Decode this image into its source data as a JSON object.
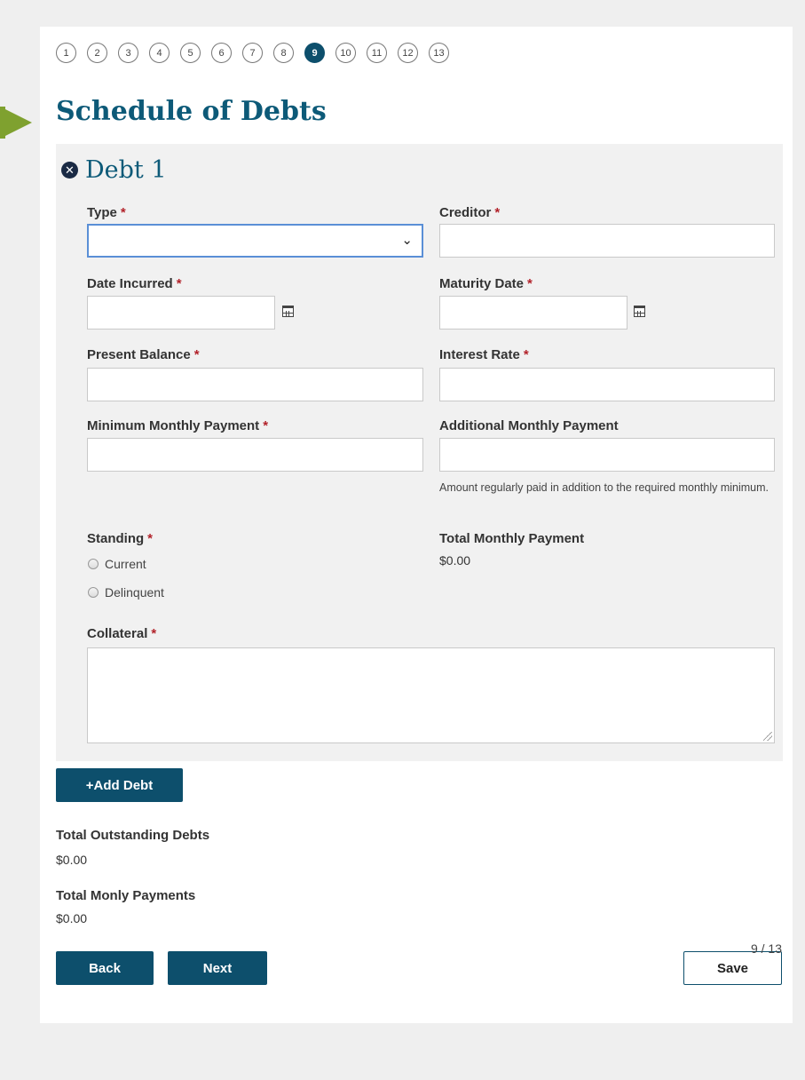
{
  "steps": {
    "items": [
      "1",
      "2",
      "3",
      "4",
      "5",
      "6",
      "7",
      "8",
      "9",
      "10",
      "11",
      "12",
      "13"
    ],
    "current": "9"
  },
  "page_title": "Schedule of Debts",
  "debt": {
    "title": "Debt 1",
    "remove_icon": "close-circle-icon",
    "type": {
      "label": "Type",
      "value": ""
    },
    "creditor": {
      "label": "Creditor",
      "value": ""
    },
    "date_incurred": {
      "label": "Date Incurred",
      "value": ""
    },
    "maturity_date": {
      "label": "Maturity Date",
      "value": ""
    },
    "present_balance": {
      "label": "Present Balance",
      "value": ""
    },
    "interest_rate": {
      "label": "Interest Rate",
      "value": ""
    },
    "minimum_monthly_payment": {
      "label": "Minimum Monthly Payment",
      "value": ""
    },
    "additional_monthly_payment": {
      "label": "Additional Monthly Payment",
      "value": "",
      "hint": "Amount regularly paid in addition to the required monthly minimum."
    },
    "standing": {
      "label": "Standing",
      "options": [
        "Current",
        "Delinquent"
      ]
    },
    "total_monthly_payment": {
      "label": "Total Monthly Payment",
      "value": "$0.00"
    },
    "collateral": {
      "label": "Collateral",
      "value": ""
    },
    "required_marker": "*"
  },
  "add_debt_label": "+Add Debt",
  "totals": {
    "outstanding_label": "Total Outstanding Debts",
    "outstanding_value": "$0.00",
    "payments_label": "Total Monly Payments",
    "payments_value": "$0.00"
  },
  "nav": {
    "back_label": "Back",
    "next_label": "Next",
    "save_label": "Save"
  },
  "page_counter": "9 / 13",
  "colors": {
    "accent": "#0d4f6c",
    "title": "#0d5a78",
    "required": "#b2222a",
    "arrow": "#7fa12f"
  }
}
